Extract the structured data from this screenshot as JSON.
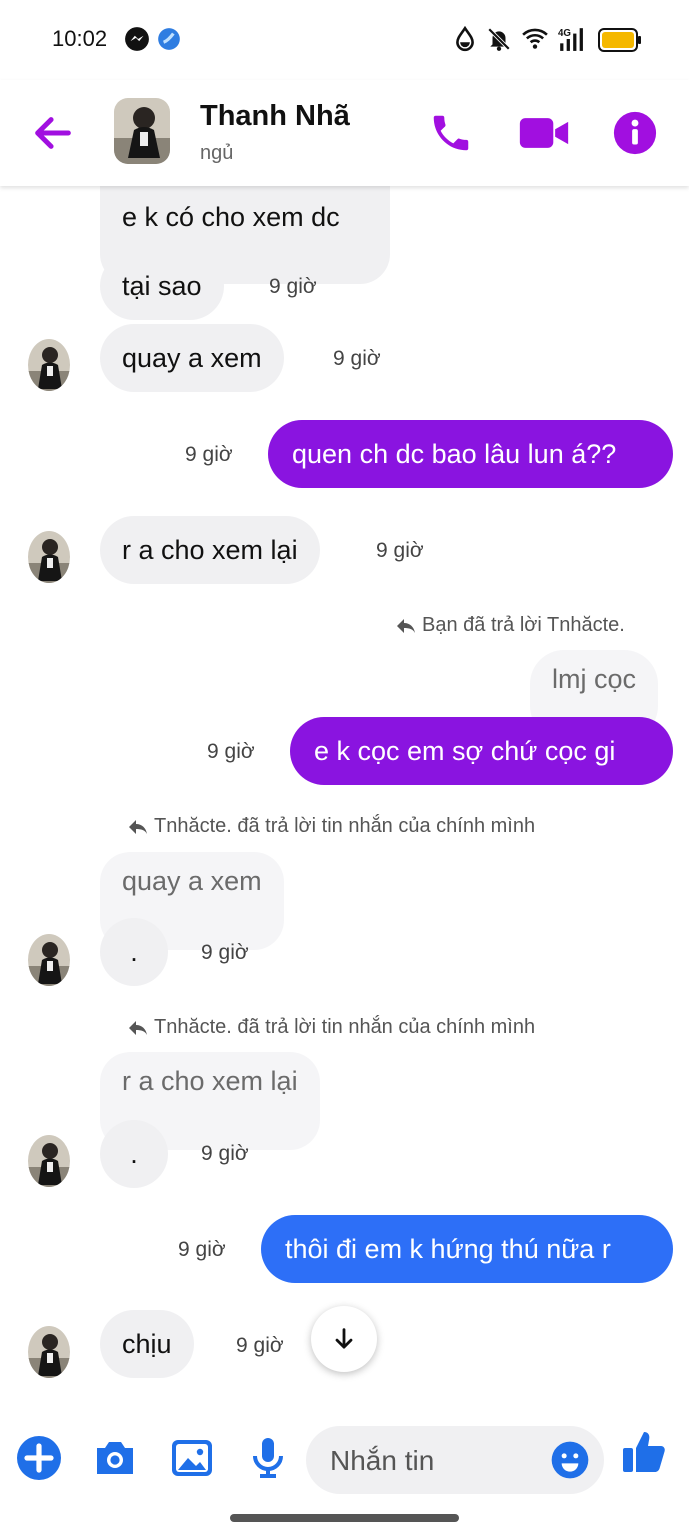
{
  "status_bar": {
    "time": "10:02"
  },
  "header": {
    "contact_name": "Thanh Nhã",
    "contact_status": "ngủ"
  },
  "colors": {
    "accent": "#a10fe0",
    "outgoing_bubble": "#8a14e0",
    "outgoing_bubble_latest": "#2d6ff7",
    "incoming_bubble": "#f0f0f2",
    "composer_icons": "#1f6fe8"
  },
  "messages": [
    {
      "text": "e k có cho xem dc"
    },
    {
      "text": "tại sao",
      "time": "9 giờ"
    },
    {
      "text": "quay a xem",
      "time": "9 giờ"
    },
    {
      "text": "quen ch dc bao lâu lun á??",
      "time": "9 giờ"
    },
    {
      "text": "r a cho xem lại",
      "time": "9 giờ"
    },
    {
      "reply_note": "Bạn đã trả lời Tnhăcte.",
      "quoted": "lmj cọc",
      "text": "e k cọc em sợ chứ cọc gi",
      "time": "9 giờ"
    },
    {
      "reply_note": "Tnhăcte. đã trả lời tin nhắn của chính mình",
      "quoted": "quay a xem",
      "text": ".",
      "time": "9 giờ"
    },
    {
      "reply_note": "Tnhăcte. đã trả lời tin nhắn của chính mình",
      "quoted": "r a cho xem lại",
      "text": ".",
      "time": "9 giờ"
    },
    {
      "text": "thôi đi em k hứng thú nữa r",
      "time": "9 giờ"
    },
    {
      "text": "chịu",
      "time": "9 giờ"
    }
  ],
  "composer": {
    "placeholder": "Nhắn tin"
  }
}
